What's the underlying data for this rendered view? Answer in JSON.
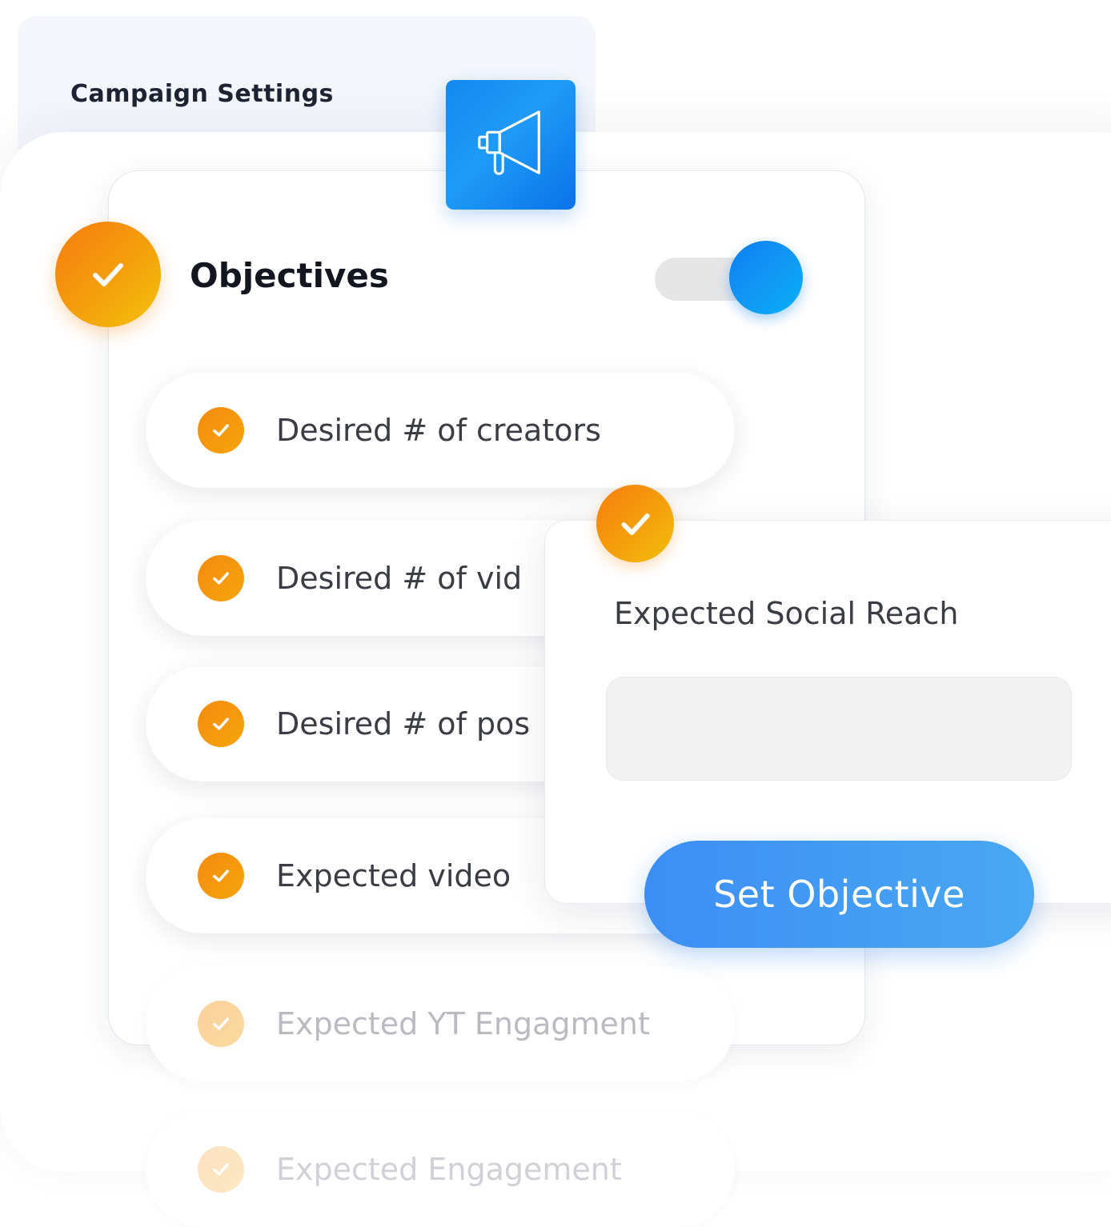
{
  "header": {
    "title": "Campaign Settings"
  },
  "section": {
    "title": "Objectives",
    "toggle_on": true
  },
  "objectives": [
    {
      "label": "Desired # of creators",
      "checked": true
    },
    {
      "label": "Desired # of vid",
      "checked": true
    },
    {
      "label": "Desired # of pos",
      "checked": true
    },
    {
      "label": "Expected video",
      "checked": true
    },
    {
      "label": "Expected YT Engagment",
      "checked": true
    },
    {
      "label": "Expected Engagement",
      "checked": true
    }
  ],
  "panel": {
    "title": "Expected Social Reach",
    "input_value": "",
    "button_label": "Set Objective"
  },
  "colors": {
    "accent_blue": "#1297f5",
    "accent_orange": "#f5a00d",
    "button_blue": "#3c8ef4"
  }
}
